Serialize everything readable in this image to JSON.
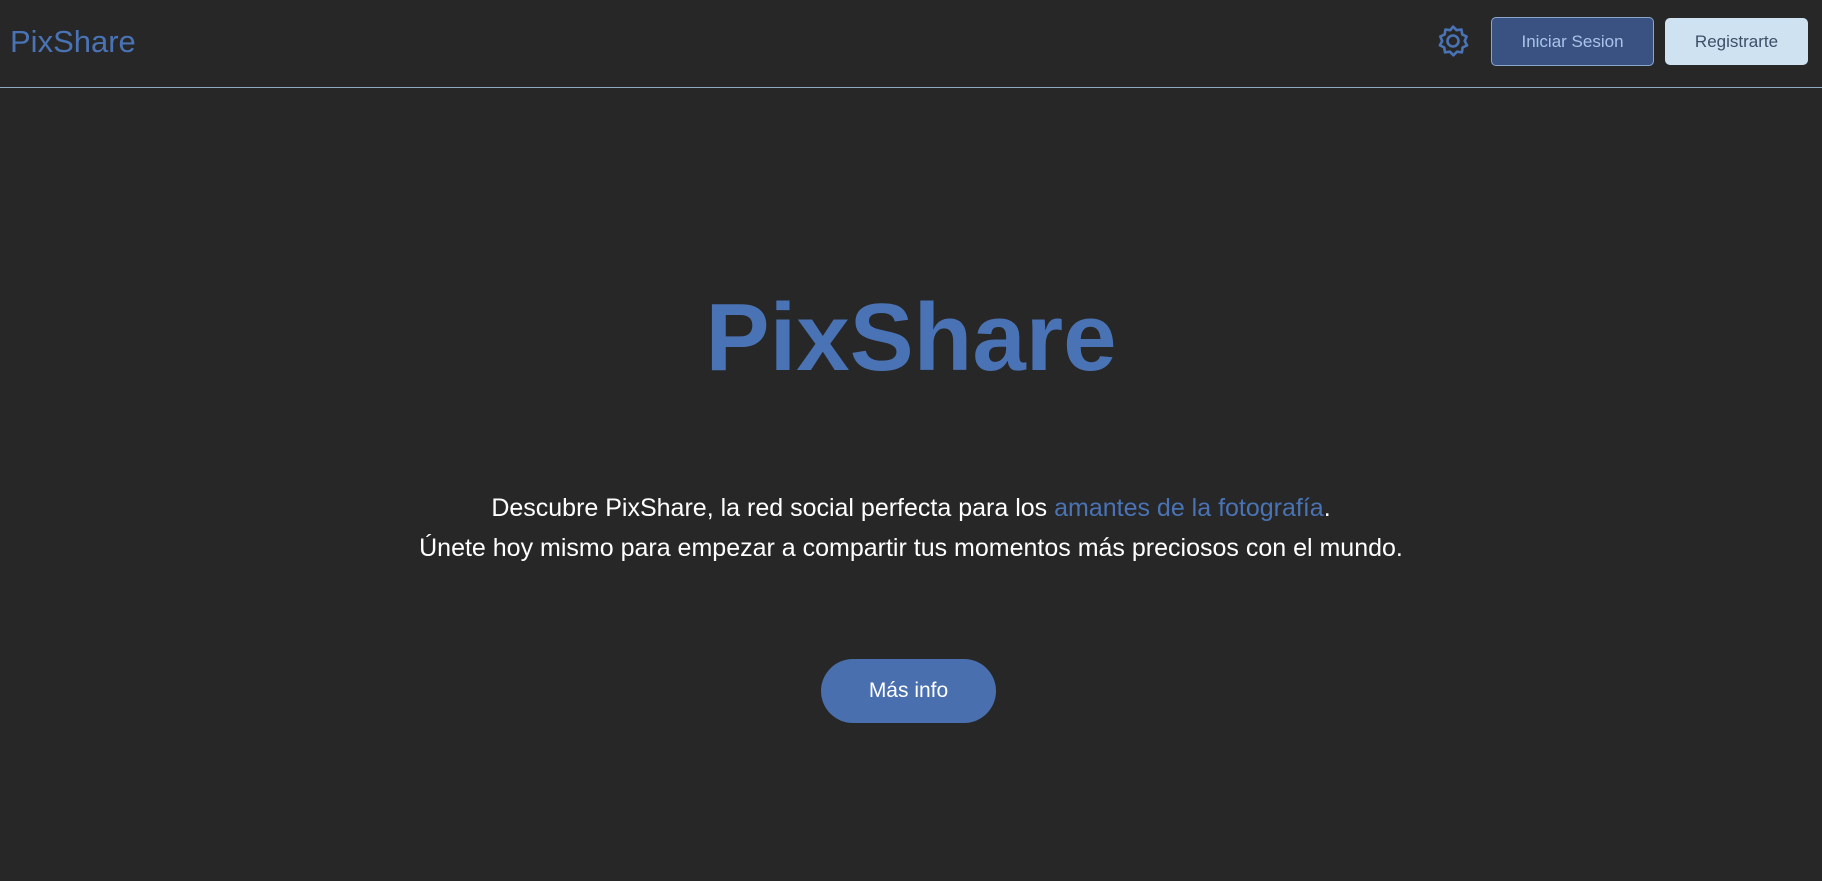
{
  "navbar": {
    "brand": "PixShare",
    "settings_icon": "gear-icon",
    "login_label": "Iniciar Sesion",
    "register_label": "Registrarte"
  },
  "hero": {
    "title": "PixShare",
    "line1_before": "Descubre PixShare, la red social perfecta para los ",
    "line1_highlight": "amantes de la fotografía",
    "line1_after": ".",
    "line2": "Únete hoy mismo para empezar a compartir tus momentos más preciosos con el mundo.",
    "button_label": "Más info"
  },
  "colors": {
    "background": "#272727",
    "accent": "#4a73b5",
    "login_bg": "#3a5282",
    "register_bg": "#cfe2f2"
  }
}
